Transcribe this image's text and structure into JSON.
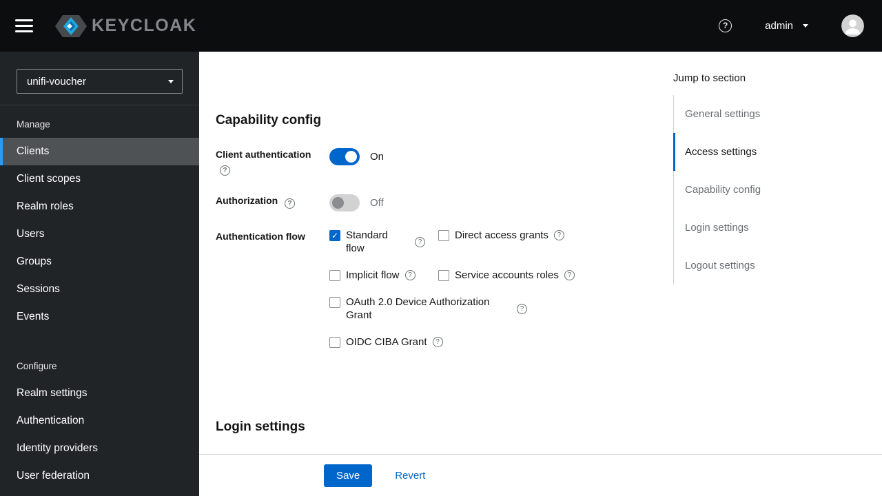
{
  "icons": {
    "help": "?"
  },
  "header": {
    "brand": "KEYCLOAK",
    "username": "admin"
  },
  "sidebar": {
    "realm_selector": "unifi-voucher",
    "manage": {
      "label": "Manage",
      "items": [
        {
          "label": "Clients",
          "active": true
        },
        {
          "label": "Client scopes",
          "active": false
        },
        {
          "label": "Realm roles",
          "active": false
        },
        {
          "label": "Users",
          "active": false
        },
        {
          "label": "Groups",
          "active": false
        },
        {
          "label": "Sessions",
          "active": false
        },
        {
          "label": "Events",
          "active": false
        }
      ]
    },
    "configure": {
      "label": "Configure",
      "items": [
        {
          "label": "Realm settings",
          "active": false
        },
        {
          "label": "Authentication",
          "active": false
        },
        {
          "label": "Identity providers",
          "active": false
        },
        {
          "label": "User federation",
          "active": false
        }
      ]
    }
  },
  "main": {
    "capability": {
      "title": "Capability config",
      "client_authentication": {
        "label": "Client authentication",
        "value": "On",
        "enabled": true
      },
      "authorization": {
        "label": "Authorization",
        "value": "Off",
        "enabled": false
      },
      "authentication_flow": {
        "label": "Authentication flow",
        "options": [
          {
            "label": "Standard flow",
            "checked": true
          },
          {
            "label": "Direct access grants",
            "checked": false
          },
          {
            "label": "Implicit flow",
            "checked": false
          },
          {
            "label": "Service accounts roles",
            "checked": false
          },
          {
            "label": "OAuth 2.0 Device Authorization Grant",
            "checked": false
          },
          {
            "label": "OIDC CIBA Grant",
            "checked": false
          }
        ]
      }
    },
    "login": {
      "title": "Login settings"
    }
  },
  "jump_links": {
    "title": "Jump to section",
    "items": [
      {
        "label": "General settings",
        "active": false
      },
      {
        "label": "Access settings",
        "active": true
      },
      {
        "label": "Capability config",
        "active": false
      },
      {
        "label": "Login settings",
        "active": false
      },
      {
        "label": "Logout settings",
        "active": false
      }
    ]
  },
  "footer": {
    "save": "Save",
    "revert": "Revert"
  },
  "colors": {
    "primary_blue": "#0066cc",
    "nav_active_border": "#2b9af3",
    "sidebar_bg": "#212427",
    "masthead_bg": "#0c0d0f"
  }
}
